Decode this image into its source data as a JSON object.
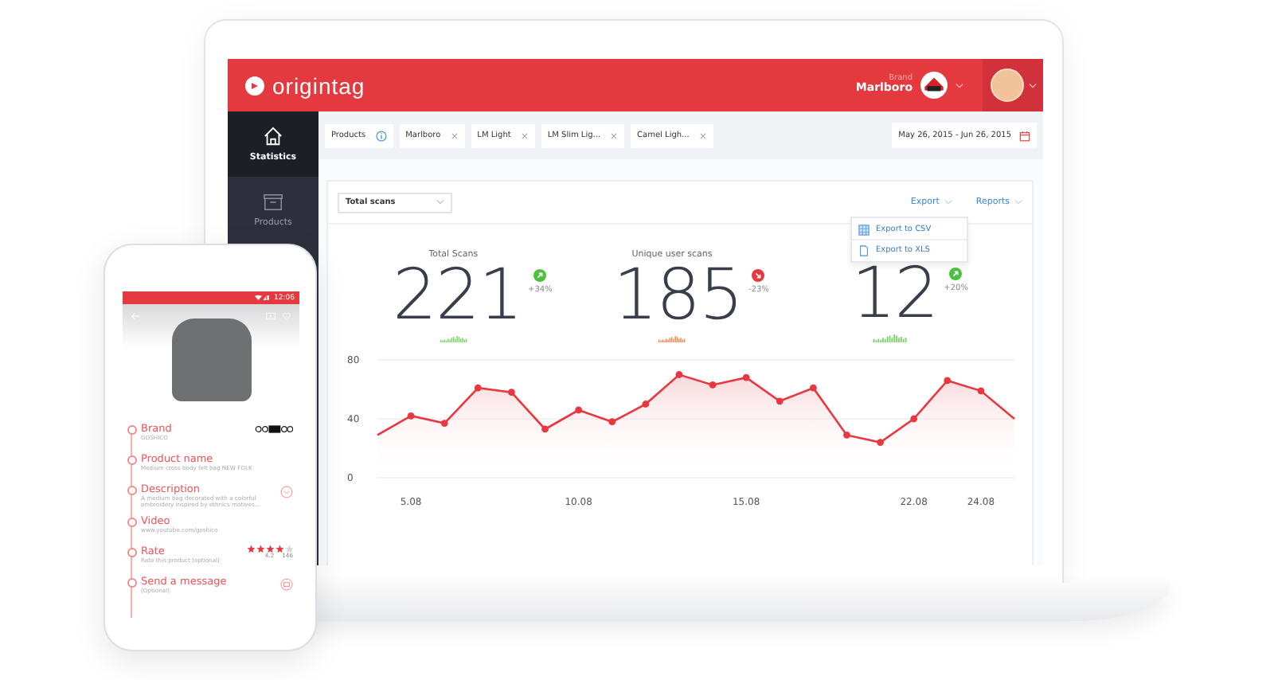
{
  "header": {
    "logo": "origintag",
    "brand_label": "Brand",
    "brand_name": "Marlboro"
  },
  "sidebar": {
    "items": [
      {
        "label": "Statistics",
        "selected": true
      },
      {
        "label": "Products",
        "selected": false
      }
    ]
  },
  "filters": {
    "chips": [
      {
        "label": "Products",
        "kind": "info"
      },
      {
        "label": "Marlboro",
        "kind": "remove"
      },
      {
        "label": "LM Light",
        "kind": "remove"
      },
      {
        "label": "LM Slim Lig...",
        "kind": "remove"
      },
      {
        "label": "Camel Ligh...",
        "kind": "remove"
      }
    ],
    "date_range": "May 26, 2015 - Jun 26, 2015"
  },
  "card": {
    "metric_select": "Total scans",
    "export": "Export",
    "reports": "Reports",
    "export_menu": [
      {
        "label": "Export to CSV",
        "kind": "csv"
      },
      {
        "label": "Export to XLS",
        "kind": "xls"
      }
    ],
    "stats": [
      {
        "label": "Total Scans",
        "value": "221",
        "change": "+34%",
        "kind": "up"
      },
      {
        "label": "Unique user scans",
        "value": "185",
        "change": "-23%",
        "kind": "down"
      },
      {
        "value": "12",
        "change": "+20%",
        "kind": "up"
      }
    ],
    "chart_data": {
      "type": "area",
      "categories": [
        null,
        "5.08",
        null,
        null,
        null,
        null,
        "10.08",
        null,
        null,
        null,
        null,
        "15.08",
        null,
        null,
        null,
        null,
        "22.08",
        null,
        "24.08",
        null
      ],
      "series": [
        {
          "color": "#e8373f",
          "marker": "o",
          "values": [
            29,
            42,
            37,
            61,
            58,
            33,
            46,
            38,
            50,
            70,
            63,
            68,
            52,
            61,
            29,
            24,
            40,
            66,
            59,
            40
          ]
        }
      ],
      "ylim": [
        0,
        80
      ],
      "yticks": [
        0,
        40,
        80
      ]
    }
  },
  "phone": {
    "time": "12:06",
    "fields": [
      {
        "label": "Brand",
        "sub": "GOSHICO",
        "kind": "logo"
      },
      {
        "label": "Product name",
        "sub": "Medium cross body felt bag NEW FOLK",
        "kind": "text"
      },
      {
        "label": "Description",
        "sub": "A medium bag decorated with a colorful embroidery inspired by ethnics motives...",
        "kind": "expand"
      },
      {
        "label": "Video",
        "sub": "www.youtube.com/goshico",
        "kind": "text"
      },
      {
        "label": "Rate",
        "sub": "Rate this product (optional)",
        "kind": "rating",
        "stars": 4,
        "score": "4.2",
        "count": "146"
      },
      {
        "label": "Send a message",
        "sub": "(Optional)",
        "kind": "message"
      }
    ]
  }
}
